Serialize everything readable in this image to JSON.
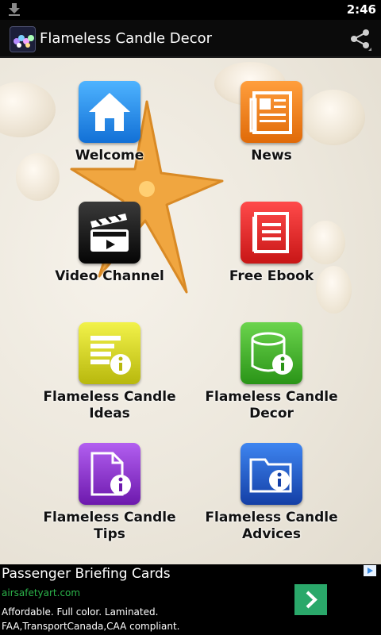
{
  "status_bar": {
    "time": "2:46",
    "download_icon": "download-icon"
  },
  "action_bar": {
    "title": "Flameless Candle Decor",
    "share_icon": "share-icon"
  },
  "tiles": [
    {
      "label": "Welcome",
      "icon": "home-icon",
      "color": "#1e8be0"
    },
    {
      "label": "News",
      "icon": "newspaper-icon",
      "color": "#f07a16"
    },
    {
      "label": "Video Channel",
      "icon": "clapperboard-icon",
      "color": "#111111"
    },
    {
      "label": "Free Ebook",
      "icon": "ebook-icon",
      "color": "#e02828"
    },
    {
      "label": "Flameless Candle\nIdeas",
      "icon": "list-info-icon",
      "color": "#d6d61c"
    },
    {
      "label": "Flameless Candle\nDecor",
      "icon": "database-info-icon",
      "color": "#3fb62a"
    },
    {
      "label": "Flameless Candle\nTips",
      "icon": "document-info-icon",
      "color": "#8a2fc7"
    },
    {
      "label": "Flameless Candle\nAdvices",
      "icon": "folder-info-icon",
      "color": "#1d5bd3"
    }
  ],
  "ad": {
    "title": "Passenger Briefing Cards",
    "url": "airsafetyart.com",
    "desc_line1": "Affordable. Full color. Laminated.",
    "desc_line2": "FAA,TransportCanada,CAA compliant.",
    "go_icon": "chevron-right-icon",
    "adchoices_icon": "adchoices-icon",
    "go_color": "#2aa86a"
  }
}
